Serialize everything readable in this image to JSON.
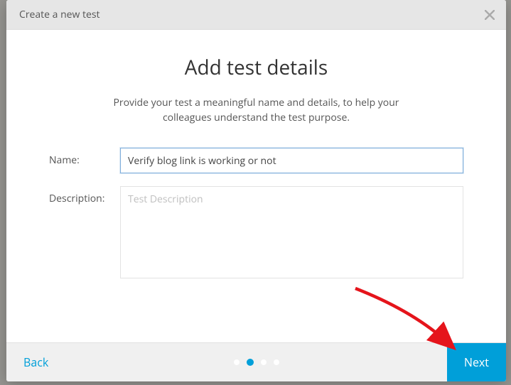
{
  "header": {
    "title": "Create a new test"
  },
  "body": {
    "heading": "Add test details",
    "subtext": "Provide your test a meaningful name and details, to help your colleagues understand the test purpose.",
    "fields": {
      "name": {
        "label": "Name:",
        "value": "Verify blog link is working or not"
      },
      "description": {
        "label": "Description:",
        "placeholder": "Test Description",
        "value": ""
      }
    }
  },
  "footer": {
    "back": "Back",
    "next": "Next",
    "steps_total": 4,
    "step_current": 2
  },
  "colors": {
    "accent": "#009fd9"
  }
}
